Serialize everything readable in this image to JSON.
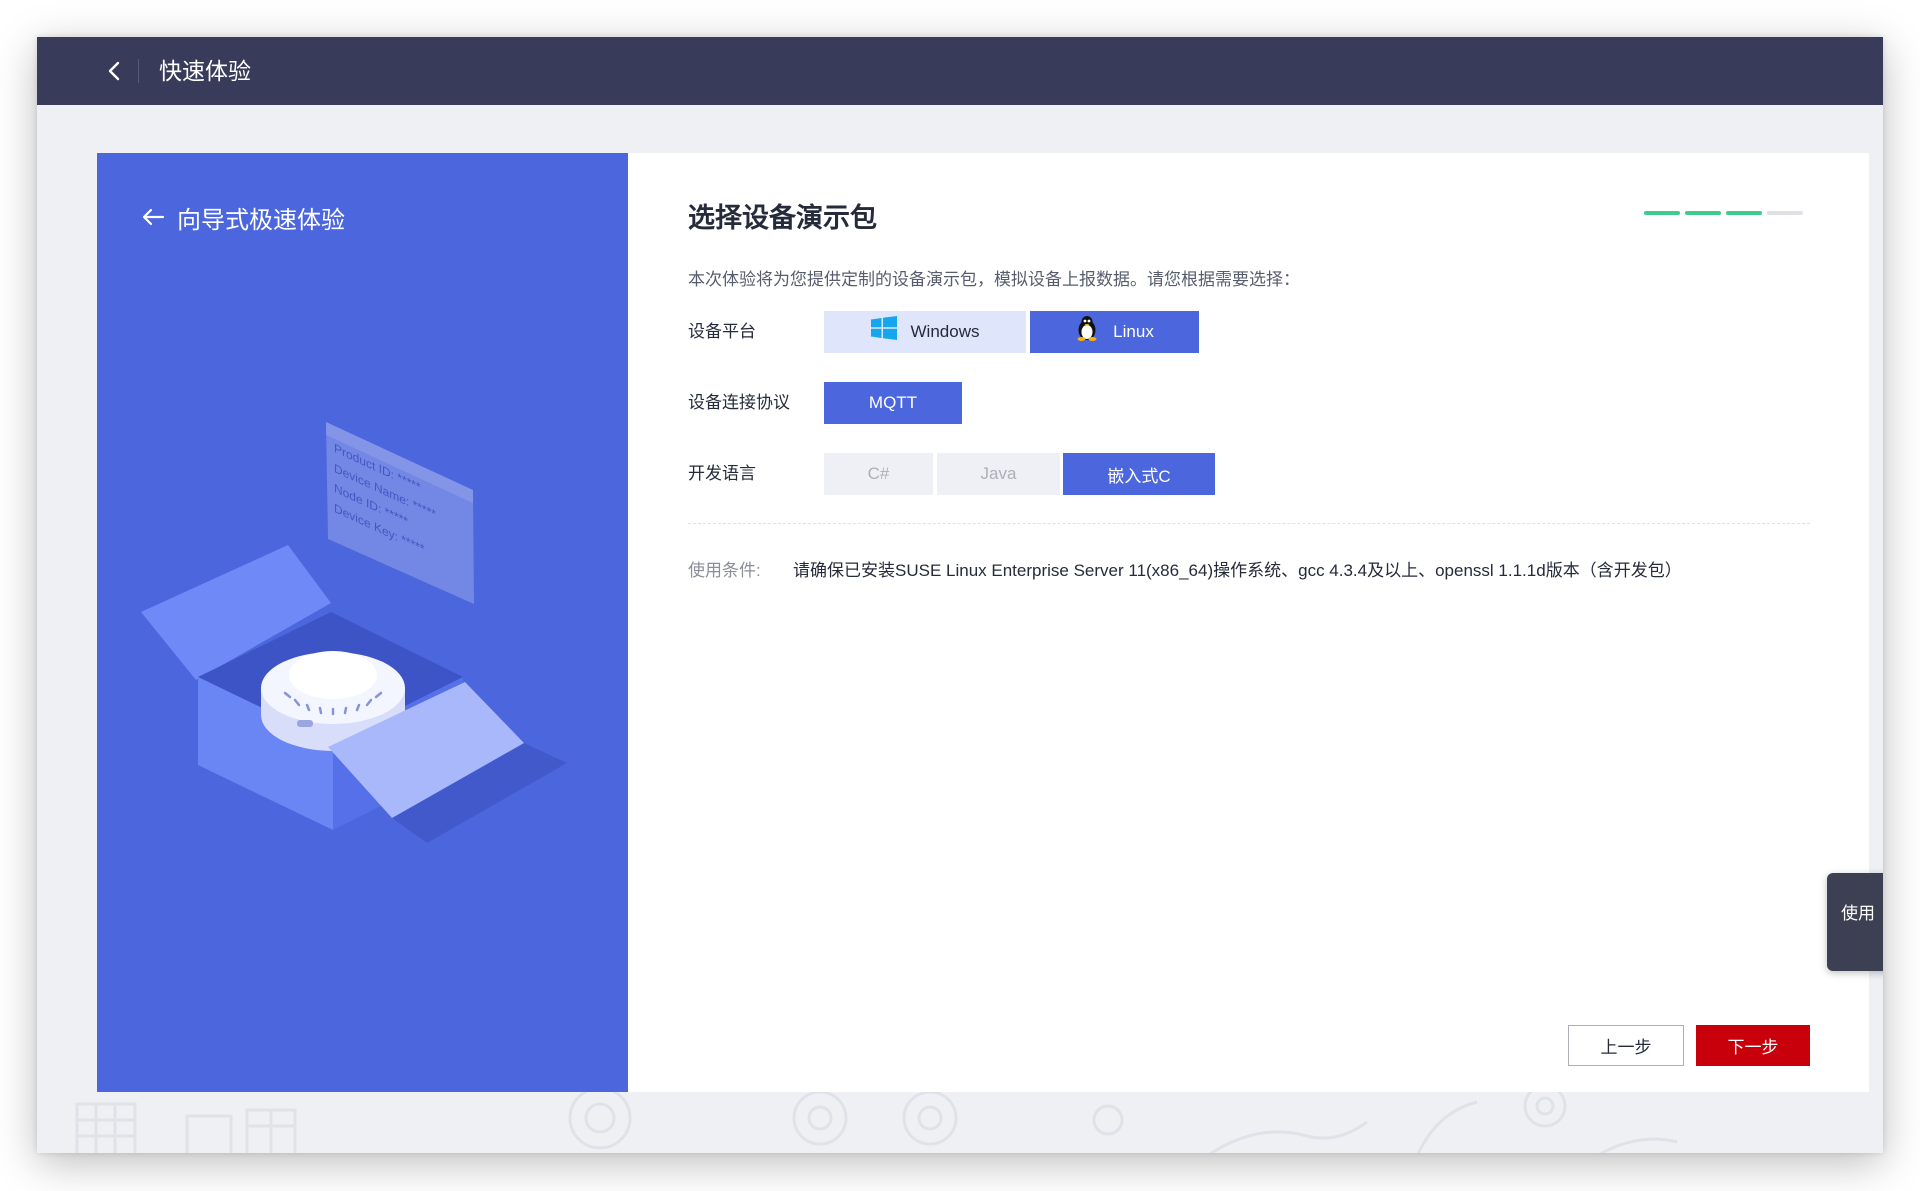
{
  "header": {
    "title": "快速体验",
    "back_icon": "chevron-left-icon"
  },
  "left_panel": {
    "title": "向导式极速体验",
    "back_icon": "arrow-left-icon",
    "card_lines": [
      "Product ID: *****",
      "Device Name: *****",
      "Node ID: *****",
      "Device Key: *****"
    ]
  },
  "main": {
    "title": "选择设备演示包",
    "progress": {
      "steps_total": 4,
      "steps_completed": 3
    },
    "description": "本次体验将为您提供定制的设备演示包，模拟设备上报数据。请您根据需要选择：",
    "platform": {
      "label": "设备平台",
      "options": [
        {
          "label": "Windows",
          "icon": "windows-icon",
          "selected": false
        },
        {
          "label": "Linux",
          "icon": "linux-penguin-icon",
          "selected": true
        }
      ]
    },
    "protocol": {
      "label": "设备连接协议",
      "options": [
        {
          "label": "MQTT",
          "selected": true
        }
      ]
    },
    "language": {
      "label": "开发语言",
      "options": [
        {
          "label": "C#",
          "selected": false,
          "disabled": true
        },
        {
          "label": "Java",
          "selected": false,
          "disabled": true
        },
        {
          "label": "嵌入式C",
          "selected": true,
          "disabled": false
        }
      ]
    },
    "requirement": {
      "label": "使用条件:",
      "text": "请确保已安装SUSE Linux Enterprise Server 11(x86_64)操作系统、gcc 4.3.4及以上、openssl 1.1.1d版本（含开发包）"
    }
  },
  "footer": {
    "prev_label": "上一步",
    "next_label": "下一步"
  },
  "side_tab": {
    "label": "使用"
  },
  "colors": {
    "primary": "#4c66dd",
    "danger": "#c7000b",
    "progress_done": "#3dcc8e",
    "progress_todo": "#dfe1e6",
    "header_bg": "#383b59"
  }
}
